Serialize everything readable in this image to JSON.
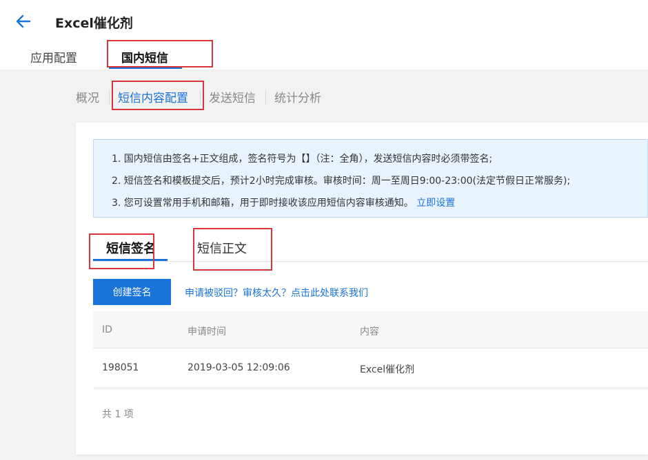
{
  "header": {
    "back_icon": "arrow-left-icon",
    "title": "Excel催化剂",
    "tabs": [
      {
        "label": "应用配置",
        "active": false
      },
      {
        "label": "国内短信",
        "active": true
      }
    ]
  },
  "subnav": {
    "items": [
      {
        "label": "概况",
        "active": false
      },
      {
        "label": "短信内容配置",
        "active": true
      },
      {
        "label": "发送短信",
        "active": false
      },
      {
        "label": "统计分析",
        "active": false
      }
    ]
  },
  "notice": {
    "lines": [
      "1. 国内短信由签名+正文组成，签名符号为【】（注：全角），发送短信内容时必须带签名;",
      "2. 短信签名和模板提交后，预计2小时完成审核。审核时间：周一至周日9:00-23:00(法定节假日正常服务);",
      "3. 您可设置常用手机和邮箱，用于即时接收该应用短信内容审核通知。"
    ],
    "link_label": "立即设置"
  },
  "inner_tabs": [
    {
      "label": "短信签名",
      "active": true
    },
    {
      "label": "短信正文",
      "active": false
    }
  ],
  "actions": {
    "create_label": "创建签名",
    "help_link": "申请被驳回？审核太久？点击此处联系我们"
  },
  "table": {
    "columns": [
      "ID",
      "申请时间",
      "内容"
    ],
    "rows": [
      {
        "id": "198051",
        "time": "2019-03-05 12:09:06",
        "content": "Excel催化剂"
      }
    ],
    "total": "共 1 项"
  },
  "colors": {
    "accent": "#1a73d9",
    "highlight_box": "#d9343a",
    "notice_bg": "#e8f3fd"
  }
}
